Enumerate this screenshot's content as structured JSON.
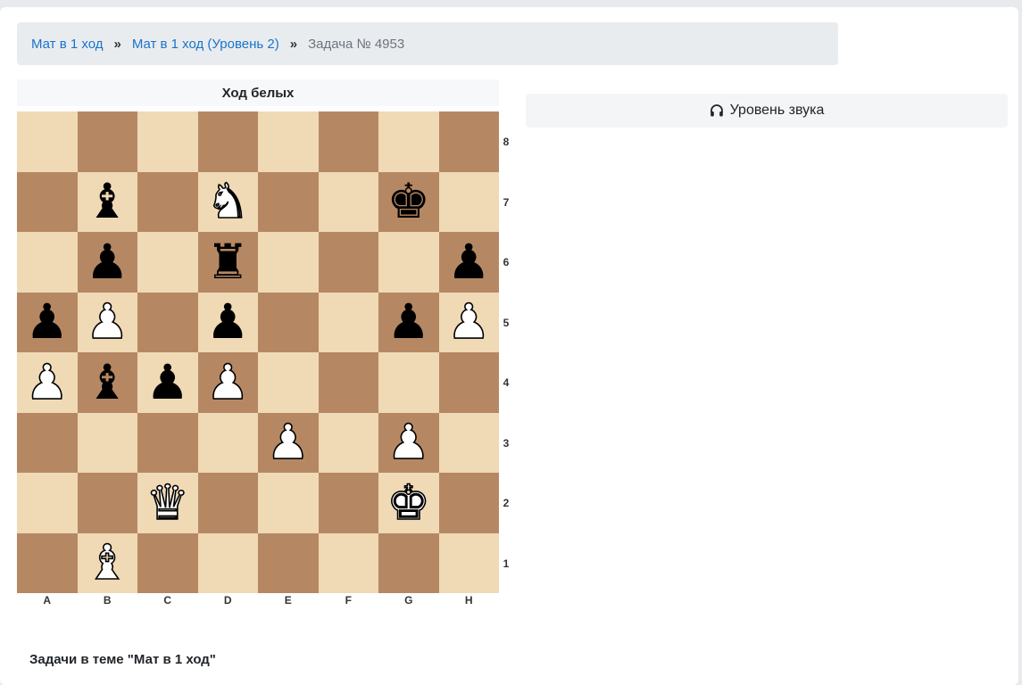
{
  "breadcrumb": {
    "item1": "Мат в 1 ход",
    "item2": "Мат в 1 ход (Уровень 2)",
    "current": "Задача № 4953",
    "separator": "»"
  },
  "board": {
    "turn_label": "Ход белых",
    "files": [
      "A",
      "B",
      "C",
      "D",
      "E",
      "F",
      "G",
      "H"
    ],
    "ranks": [
      "8",
      "7",
      "6",
      "5",
      "4",
      "3",
      "2",
      "1"
    ],
    "light_color": "#f0d9b5",
    "dark_color": "#b58863",
    "position": [
      [
        "",
        "",
        "",
        "",
        "",
        "",
        "",
        ""
      ],
      [
        "",
        "bB",
        "",
        "wN",
        "",
        "",
        "bK",
        ""
      ],
      [
        "",
        "bP",
        "",
        "bR",
        "",
        "",
        "",
        "bP"
      ],
      [
        "bP",
        "wP",
        "",
        "bP",
        "",
        "",
        "bP",
        "wP"
      ],
      [
        "wP",
        "bB",
        "bP",
        "wP",
        "",
        "",
        "",
        ""
      ],
      [
        "",
        "",
        "",
        "",
        "wP",
        "",
        "wP",
        ""
      ],
      [
        "",
        "",
        "wQ",
        "",
        "",
        "",
        "wK",
        ""
      ],
      [
        "",
        "wB",
        "",
        "",
        "",
        "",
        "",
        ""
      ]
    ]
  },
  "sound": {
    "label": "Уровень звука",
    "icon": "headphones-icon"
  },
  "theme": {
    "title": "Задачи в теме \"Мат в 1 ход\""
  }
}
